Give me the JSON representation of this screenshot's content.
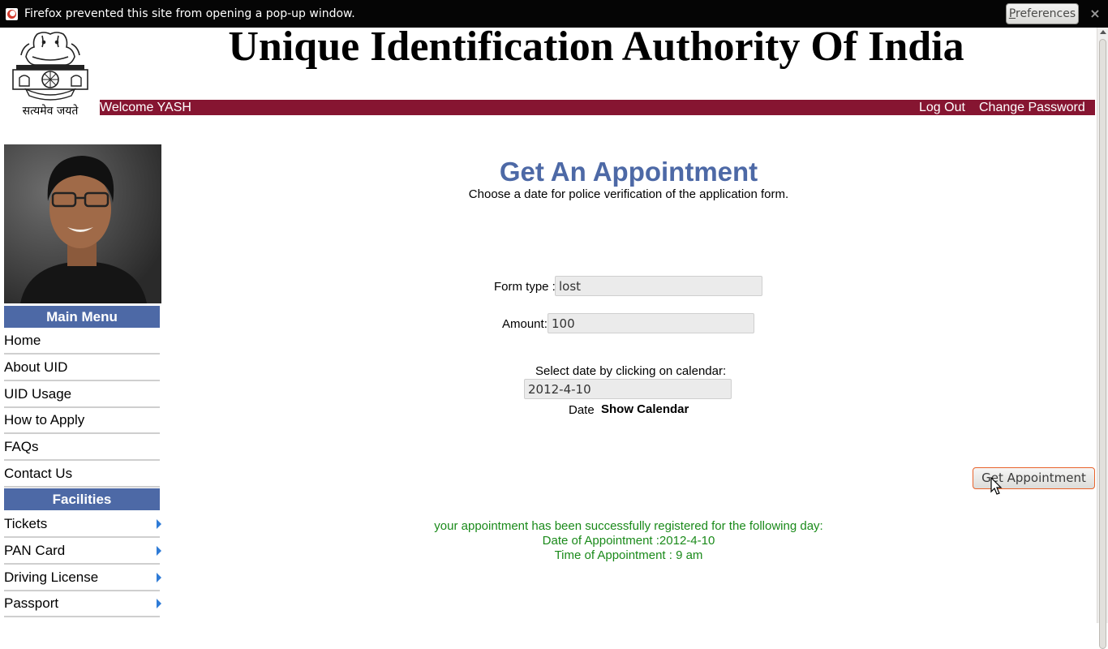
{
  "popup": {
    "message": "Firefox prevented this site from opening a pop-up window.",
    "preferences_first": "P",
    "preferences_rest": "references",
    "close_icon": "×"
  },
  "header": {
    "title": "Unique Identification Authority Of India",
    "emblem_motto": "सत्यमेव जयते",
    "welcome": "Welcome YASH",
    "logout": "Log Out",
    "change_password": "Change Password"
  },
  "sidebar": {
    "main_menu_title": "Main Menu",
    "main_menu": [
      "Home",
      "About UID",
      "UID Usage",
      "How to Apply",
      "FAQs",
      "Contact Us"
    ],
    "facilities_title": "Facilities",
    "facilities": [
      "Tickets",
      "PAN Card",
      "Driving License",
      "Passport"
    ]
  },
  "main": {
    "title": "Get An Appointment",
    "subtitle": "Choose a date for police verification of the application form.",
    "form_type_label": "Form type :",
    "form_type_value": "lost",
    "amount_label": "Amount:",
    "amount_value": "100",
    "select_date_label": "Select date by clicking on calendar:",
    "date_value": "2012-4-10",
    "date_label": "Date",
    "show_calendar": "Show Calendar",
    "submit_label": "Get Appointment",
    "success_line1": "your appointment has been successfully registered for the following day:",
    "success_line2": "Date of Appointment :2012-4-10",
    "success_line3": "Time of Appointment : 9 am"
  },
  "colors": {
    "accent_blue": "#4d69a6",
    "welcome_bar": "#861531",
    "success_green": "#1a8a1a"
  }
}
